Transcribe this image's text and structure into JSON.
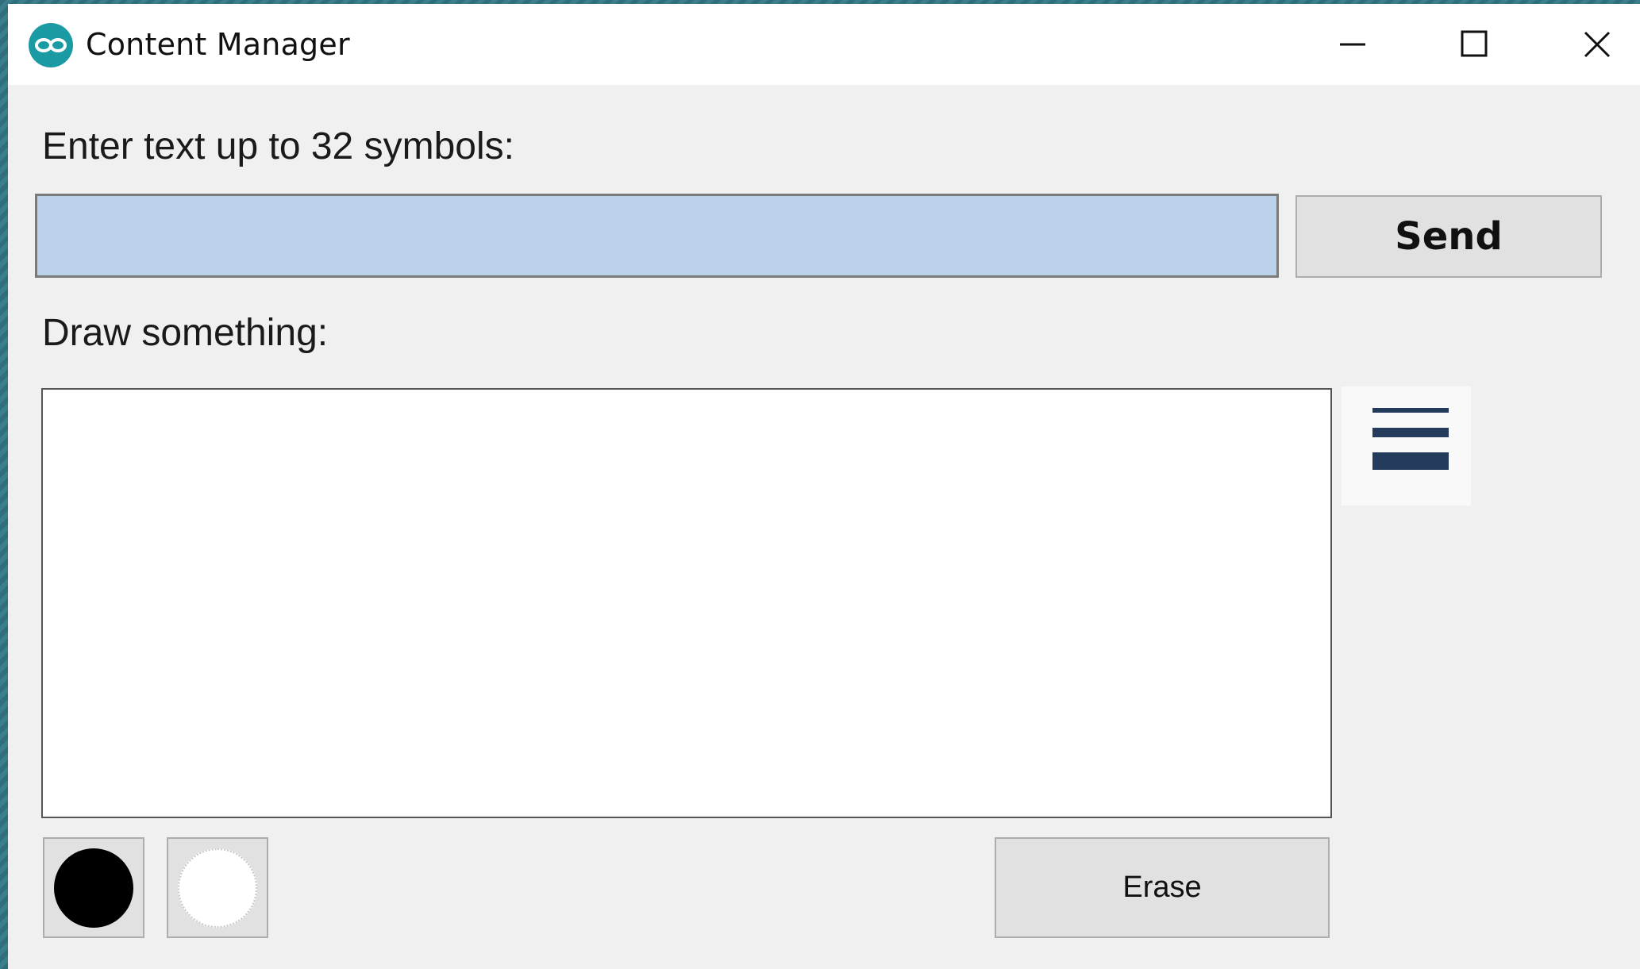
{
  "window": {
    "title": "Content Manager",
    "icon": "arduino-infinity-icon",
    "controls": [
      "minimize-icon",
      "maximize-icon",
      "close-icon"
    ]
  },
  "text_section": {
    "label": "Enter text up to 32 symbols:",
    "input_value": "",
    "send_label": "Send"
  },
  "draw_section": {
    "label": "Draw something:",
    "menu_icon": "line-thickness-icon",
    "colors": [
      {
        "name": "black",
        "hex": "#000000"
      },
      {
        "name": "white",
        "hex": "#ffffff"
      }
    ],
    "erase_label": "Erase"
  },
  "colors": {
    "input_selection": "#bcd1ea",
    "accent": "#1a9ba3",
    "button_face": "#e1e1e1",
    "menu_bars": "#253b5c"
  }
}
